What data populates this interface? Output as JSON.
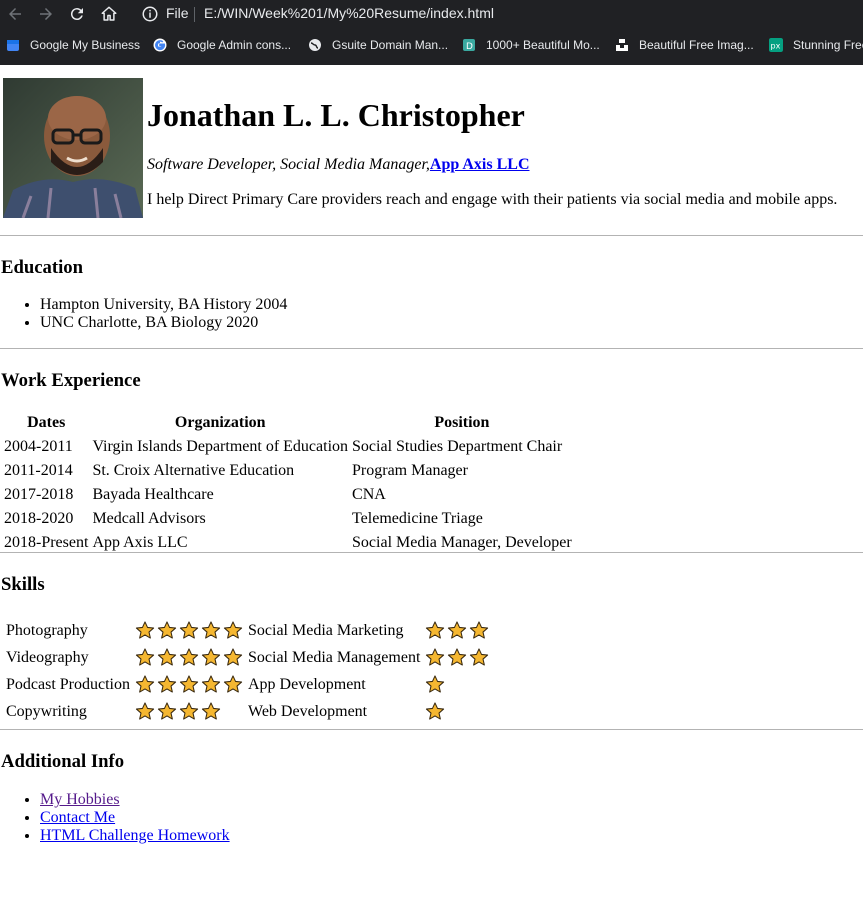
{
  "browser": {
    "file_label": "File",
    "url": "E:/WIN/Week%201/My%20Resume/index.html",
    "bookmarks": [
      {
        "label": "Google My Business",
        "icon": "google-my-business-icon",
        "color": "#4285f4"
      },
      {
        "label": "Google Admin cons...",
        "icon": "google-g-icon",
        "color": "#ffffff"
      },
      {
        "label": "Gsuite Domain Man...",
        "icon": "globe-icon",
        "color": "#e8eaed"
      },
      {
        "label": "1000+ Beautiful Mo...",
        "icon": "d-logo-icon",
        "color": "#3aa9a0"
      },
      {
        "label": "Beautiful Free Imag...",
        "icon": "unsplash-icon",
        "color": "#ffffff"
      },
      {
        "label": "Stunning Free",
        "icon": "pexels-icon",
        "color": "#05a081"
      }
    ]
  },
  "header": {
    "name": "Jonathan L. L. Christopher",
    "role": "Software Developer, Social Media Manager,",
    "company_link": "App Axis LLC",
    "bio": "I help Direct Primary Care providers reach and engage with their patients via social media and mobile apps."
  },
  "education": {
    "heading": "Education",
    "items": [
      "Hampton University, BA History 2004",
      "UNC Charlotte, BA Biology 2020"
    ]
  },
  "work": {
    "heading": "Work Experience",
    "columns": [
      "Dates",
      "Organization",
      "Position"
    ],
    "rows": [
      [
        "2004-2011",
        "Virgin Islands Department of Education",
        "Social Studies Department Chair"
      ],
      [
        "2011-2014",
        "St. Croix Alternative Education",
        "Program Manager"
      ],
      [
        "2017-2018",
        "Bayada Healthcare",
        "CNA"
      ],
      [
        "2018-2020",
        "Medcall Advisors",
        "Telemedicine Triage"
      ],
      [
        "2018-Present",
        "App Axis LLC",
        "Social Media Manager, Developer"
      ]
    ]
  },
  "skills": {
    "heading": "Skills",
    "star_color": "#f5b731",
    "rows": [
      {
        "left": "Photography",
        "left_stars": 5,
        "right": "Social Media Marketing",
        "right_stars": 3
      },
      {
        "left": "Videography",
        "left_stars": 5,
        "right": "Social Media Management",
        "right_stars": 3
      },
      {
        "left": "Podcast Production",
        "left_stars": 5,
        "right": "App Development",
        "right_stars": 1
      },
      {
        "left": "Copywriting",
        "left_stars": 4,
        "right": "Web Development",
        "right_stars": 1
      }
    ]
  },
  "additional": {
    "heading": "Additional Info",
    "links": [
      "My Hobbies",
      "Contact Me",
      "HTML Challenge Homework"
    ]
  }
}
